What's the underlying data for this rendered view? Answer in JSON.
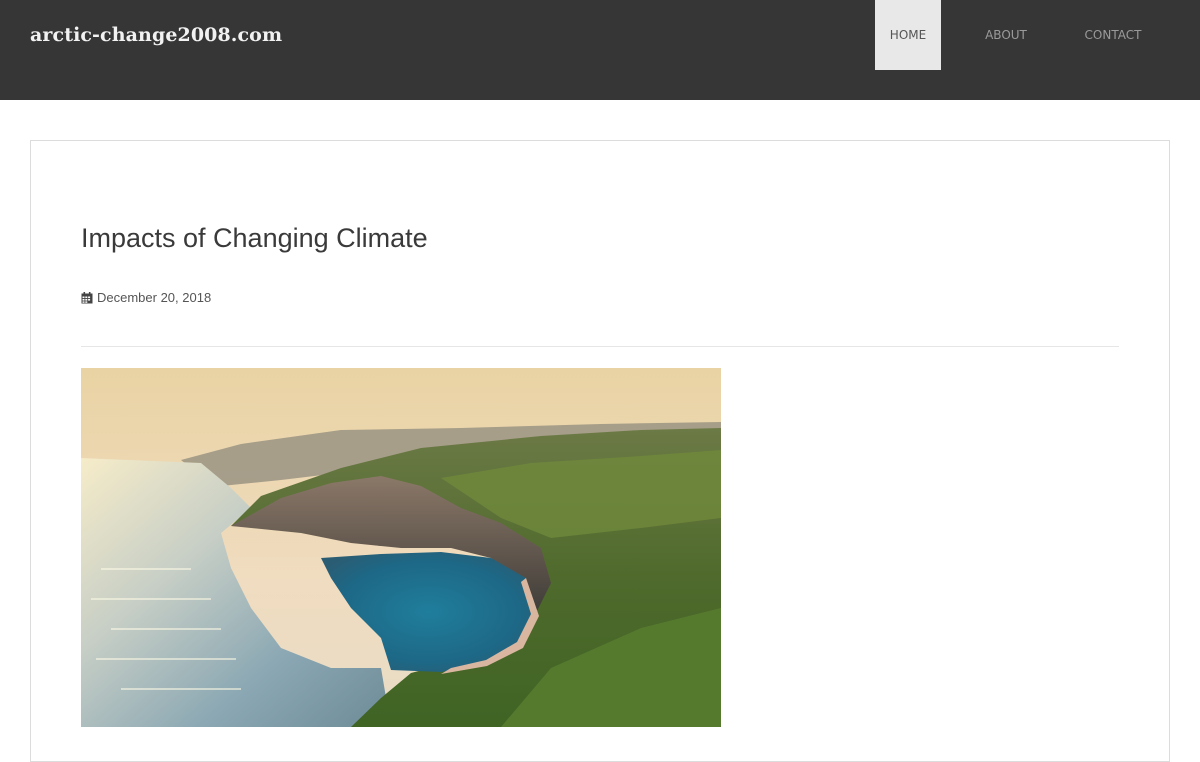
{
  "site": {
    "title": "arctic-change2008.com"
  },
  "nav": {
    "items": [
      {
        "label": "HOME",
        "active": true
      },
      {
        "label": "ABOUT",
        "active": false
      },
      {
        "label": "CONTACT",
        "active": false
      }
    ]
  },
  "post": {
    "title": "Impacts of Changing Climate",
    "date": "December 20, 2018",
    "date_icon": "calendar-icon",
    "image": {
      "subject": "aerial-coastline-cove"
    }
  },
  "colors": {
    "header_bg": "#363636",
    "nav_active_bg": "#e8e8e8",
    "nav_text": "#9a9a9a",
    "title_text": "#3a3a3a"
  }
}
